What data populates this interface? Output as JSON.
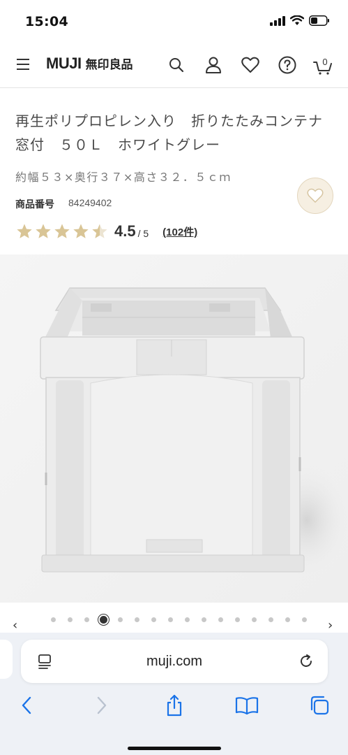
{
  "status_bar": {
    "time": "15:04"
  },
  "header": {
    "logo_en": "MUJI",
    "logo_jp": "無印良品",
    "cart_count": "0"
  },
  "product": {
    "title": "再生ポリプロピレン入り　折りたたみコンテナ　窓付　５０Ｌ　ホワイトグレー",
    "size": "約幅５３×奥行３７×高さ３２．５ｃｍ",
    "sku_label": "商品番号",
    "sku_value": "84249402",
    "rating_score": "4.5",
    "rating_max": "/ 5",
    "rating_count": "(102件)",
    "rating_value": 4.5
  },
  "carousel": {
    "total": 16,
    "active_index": 3,
    "prev": "‹",
    "next": "›"
  },
  "browser": {
    "url": "muji.com"
  },
  "colors": {
    "star": "#d9c596",
    "accent_bg": "#f6efe2",
    "link_blue": "#1a73e8"
  }
}
